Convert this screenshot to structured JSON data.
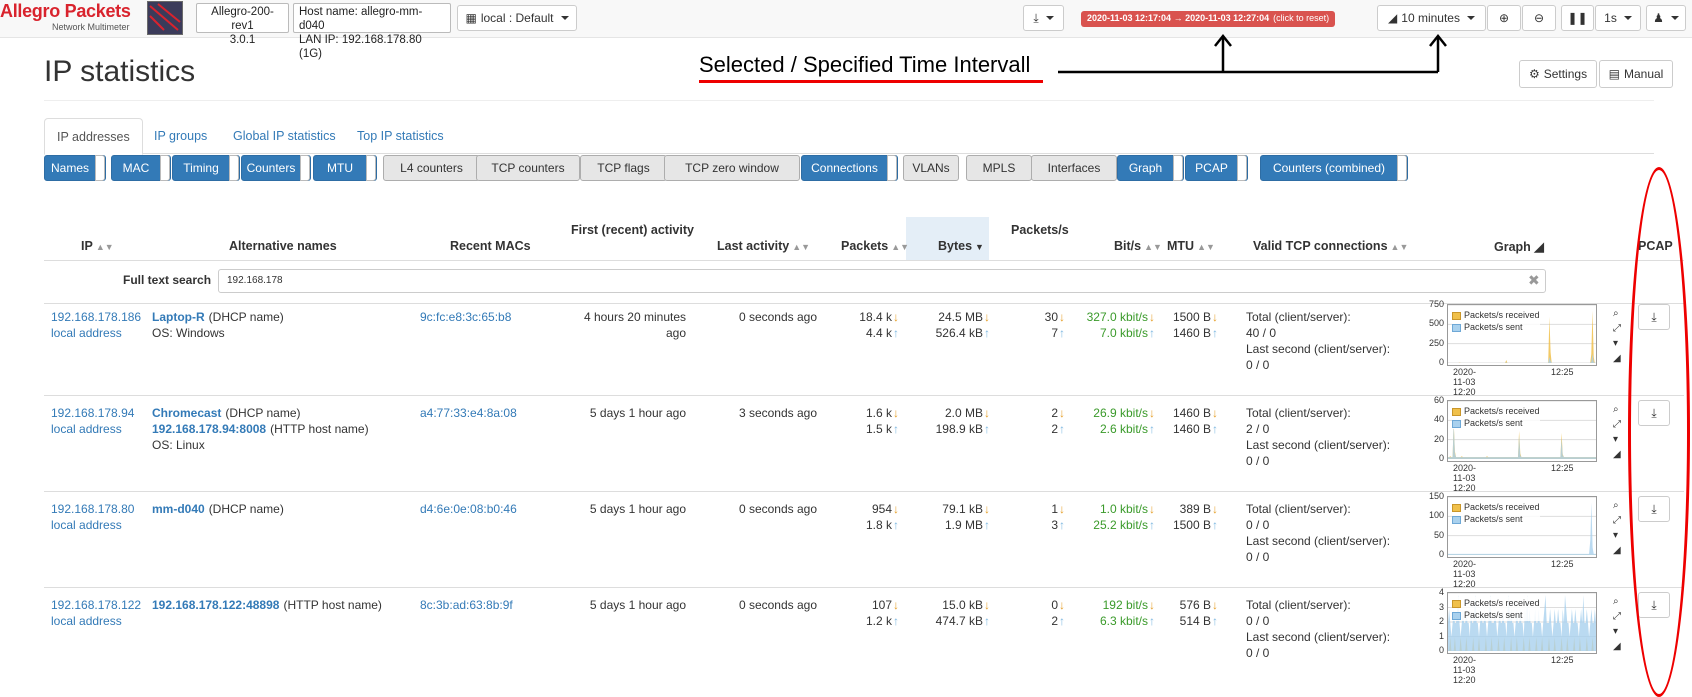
{
  "brand": {
    "title": "Allegro Packets",
    "subtitle": "Network Multimeter"
  },
  "device": {
    "model": "Allegro-200-rev1",
    "version": "3.0.1"
  },
  "host": {
    "hostname": "Host name: allegro-mm-d040",
    "lan_ip": "LAN IP: 192.168.178.80 (1G)"
  },
  "dashboard_select": "local : Default",
  "time_range": {
    "text": "2020-11-03 12:17:04 → 2020-11-03 12:27:04",
    "hint": "(click to reset)"
  },
  "interval_select": "10 minutes",
  "refresh_select": "1s",
  "annotation": "Selected / Specified Time Intervall",
  "page_title": "IP statistics",
  "header_buttons": {
    "settings": "Settings",
    "manual": "Manual"
  },
  "tabs": [
    "IP addresses",
    "IP groups",
    "Global IP statistics",
    "Top IP statistics"
  ],
  "column_toggles": [
    {
      "label": "Names",
      "on": true
    },
    {
      "label": "MAC",
      "on": true
    },
    {
      "label": "Timing",
      "on": true
    },
    {
      "label": "Counters",
      "on": true
    },
    {
      "label": "MTU",
      "on": true
    },
    {
      "label": "L4 counters",
      "on": false
    },
    {
      "label": "TCP counters",
      "on": false
    },
    {
      "label": "TCP flags",
      "on": false
    },
    {
      "label": "TCP zero window",
      "on": false
    },
    {
      "label": "Connections",
      "on": true
    },
    {
      "label": "VLANs",
      "on": false
    },
    {
      "label": "MPLS",
      "on": false
    },
    {
      "label": "Interfaces",
      "on": false
    },
    {
      "label": "Graph",
      "on": true
    },
    {
      "label": "PCAP",
      "on": true
    },
    {
      "label": "Counters (combined)",
      "on": true
    }
  ],
  "columns": {
    "ip": "IP",
    "alt_names": "Alternative names",
    "recent_macs": "Recent MACs",
    "first_activity": "First (recent) activity",
    "last_activity": "Last activity",
    "packets": "Packets",
    "bytes": "Bytes",
    "packets_s": "Packets/s",
    "bits_s": "Bit/s",
    "mtu": "MTU",
    "tcp_conn": "Valid TCP connections",
    "graph": "Graph",
    "pcap": "PCAP"
  },
  "search": {
    "label": "Full text search",
    "value": "192.168.178"
  },
  "legend": {
    "received": "Packets/s received",
    "sent": "Packets/s sent"
  },
  "graph_xlabels": [
    "2020-11-03 12:20",
    "12:25"
  ],
  "conn_labels": {
    "total": "Total (client/server):",
    "last": "Last second (client/server):"
  },
  "rows": [
    {
      "ip": "192.168.178.186",
      "ip_note": "local address",
      "name1": "Laptop-R",
      "name1_suffix": "(DHCP name)",
      "name2": "",
      "name2_suffix": "",
      "os": "OS: Windows",
      "mac": "9c:fc:e8:3c:65:b8",
      "first": [
        "4 hours 20 minutes",
        "ago"
      ],
      "last": "0 seconds ago",
      "packets_rx": "18.4 k",
      "packets_tx": "4.4 k",
      "bytes_rx": "24.5 MB",
      "bytes_tx": "526.4 kB",
      "pps_rx": "30",
      "pps_tx": "7",
      "bps_rx": "327.0 kbit/s",
      "bps_tx": "7.0 kbit/s",
      "mtu_rx": "1500 B",
      "mtu_tx": "1460 B",
      "conn_total": "40 / 0",
      "conn_last": "0 / 0",
      "yticks": [
        "750",
        "500",
        "250",
        "0"
      ],
      "ymax": 750,
      "received": [
        0,
        0,
        0,
        0,
        0,
        0,
        0,
        0,
        0,
        0,
        5,
        0,
        0,
        0,
        0,
        0,
        0,
        0,
        0,
        0,
        0,
        0,
        0,
        0,
        0,
        0,
        0,
        0,
        0,
        0,
        0,
        0,
        0,
        0,
        0,
        0,
        0,
        0,
        0,
        0,
        0,
        0,
        0,
        0,
        0,
        0,
        0,
        0,
        0,
        0,
        40,
        0,
        0,
        0,
        0,
        0,
        0,
        0,
        0,
        0,
        0,
        0,
        0,
        0,
        0,
        0,
        0,
        0,
        0,
        0,
        0,
        0,
        0,
        0,
        0,
        0,
        0,
        0,
        0,
        0,
        0,
        0,
        0,
        0,
        0,
        0,
        0,
        620,
        140,
        0,
        0,
        0,
        0,
        0,
        0,
        0,
        0,
        0,
        0,
        0,
        0,
        0,
        0,
        0,
        0,
        0,
        0,
        0,
        0,
        0,
        0,
        0,
        0,
        0,
        0,
        0,
        0,
        0,
        0,
        0,
        0,
        0,
        0,
        120,
        700,
        80,
        0,
        0
      ],
      "sent": [
        0,
        0,
        0,
        0,
        0,
        0,
        0,
        0,
        0,
        0,
        2,
        0,
        0,
        0,
        0,
        0,
        0,
        0,
        0,
        0,
        0,
        0,
        0,
        0,
        0,
        0,
        0,
        0,
        0,
        0,
        0,
        0,
        0,
        0,
        0,
        0,
        0,
        0,
        0,
        0,
        0,
        0,
        0,
        0,
        0,
        0,
        0,
        0,
        0,
        0,
        10,
        0,
        0,
        0,
        0,
        0,
        0,
        0,
        0,
        0,
        0,
        0,
        0,
        0,
        0,
        0,
        0,
        0,
        0,
        0,
        0,
        0,
        0,
        0,
        0,
        0,
        0,
        0,
        0,
        0,
        0,
        0,
        0,
        0,
        0,
        0,
        0,
        80,
        30,
        0,
        0,
        0,
        0,
        0,
        0,
        0,
        0,
        0,
        0,
        0,
        0,
        0,
        0,
        0,
        0,
        0,
        0,
        0,
        0,
        0,
        0,
        0,
        0,
        0,
        0,
        0,
        0,
        0,
        0,
        0,
        0,
        0,
        0,
        20,
        120,
        15,
        0,
        0
      ]
    },
    {
      "ip": "192.168.178.94",
      "ip_note": "local address",
      "name1": "Chromecast",
      "name1_suffix": "(DHCP name)",
      "name2": "192.168.178.94:8008",
      "name2_suffix": "(HTTP host name)",
      "os": "OS: Linux",
      "mac": "a4:77:33:e4:8a:08",
      "first": [
        "5 days 1 hour ago"
      ],
      "last": "3 seconds ago",
      "packets_rx": "1.6 k",
      "packets_tx": "1.5 k",
      "bytes_rx": "2.0 MB",
      "bytes_tx": "198.9 kB",
      "pps_rx": "2",
      "pps_tx": "2",
      "bps_rx": "26.9 kbit/s",
      "bps_tx": "2.6 kbit/s",
      "mtu_rx": "1460 B",
      "mtu_tx": "1460 B",
      "conn_total": "2 / 0",
      "conn_last": "0 / 0",
      "yticks": [
        "60",
        "40",
        "20",
        "0"
      ],
      "ymax": 60,
      "received": [
        2,
        2,
        3,
        2,
        2,
        40,
        8,
        2,
        2,
        2,
        2,
        2,
        3,
        2,
        2,
        2,
        2,
        2,
        2,
        2,
        2,
        2,
        2,
        2,
        2,
        2,
        2,
        2,
        2,
        2,
        2,
        2,
        2,
        2,
        3,
        2,
        2,
        2,
        2,
        2,
        2,
        2,
        2,
        2,
        2,
        2,
        2,
        2,
        2,
        2,
        2,
        2,
        2,
        2,
        2,
        2,
        2,
        2,
        2,
        2,
        2,
        2,
        30,
        6,
        2,
        2,
        2,
        2,
        2,
        2,
        2,
        2,
        2,
        2,
        2,
        2,
        2,
        2,
        2,
        2,
        2,
        2,
        2,
        2,
        2,
        2,
        2,
        2,
        2,
        2,
        2,
        2,
        2,
        2,
        2,
        2,
        2,
        2,
        2,
        28,
        5,
        2,
        2,
        2,
        2,
        2,
        2,
        2,
        2,
        2,
        2,
        2,
        2,
        2,
        2,
        2,
        2,
        2,
        2,
        2,
        2,
        2,
        2,
        2,
        2,
        2,
        2,
        2,
        2,
        2
      ],
      "sent": [
        2,
        2,
        2,
        2,
        2,
        38,
        6,
        2,
        2,
        2,
        2,
        2,
        2,
        2,
        2,
        2,
        2,
        2,
        2,
        2,
        2,
        2,
        2,
        2,
        2,
        2,
        2,
        2,
        2,
        2,
        2,
        2,
        2,
        2,
        2,
        2,
        2,
        2,
        2,
        2,
        2,
        2,
        2,
        2,
        2,
        2,
        2,
        2,
        2,
        2,
        2,
        2,
        2,
        2,
        2,
        2,
        2,
        2,
        2,
        2,
        2,
        2,
        25,
        4,
        2,
        2,
        2,
        2,
        2,
        2,
        2,
        2,
        2,
        2,
        2,
        2,
        2,
        2,
        2,
        2,
        2,
        2,
        2,
        2,
        2,
        2,
        2,
        2,
        2,
        2,
        2,
        2,
        2,
        2,
        2,
        2,
        2,
        2,
        2,
        22,
        4,
        2,
        2,
        2,
        2,
        2,
        2,
        2,
        2,
        2,
        2,
        2,
        2,
        2,
        2,
        2,
        2,
        2,
        2,
        2,
        2,
        2,
        2,
        2,
        2,
        2,
        2,
        2,
        2,
        2
      ]
    },
    {
      "ip": "192.168.178.80",
      "ip_note": "local address",
      "name1": "mm-d040",
      "name1_suffix": "(DHCP name)",
      "name2": "",
      "name2_suffix": "",
      "os": "",
      "mac": "d4:6e:0e:08:b0:46",
      "first": [
        "5 days 1 hour ago"
      ],
      "last": "0 seconds ago",
      "packets_rx": "954",
      "packets_tx": "1.8 k",
      "bytes_rx": "79.1 kB",
      "bytes_tx": "1.9 MB",
      "pps_rx": "1",
      "pps_tx": "3",
      "bps_rx": "1.0 kbit/s",
      "bps_tx": "25.2 kbit/s",
      "mtu_rx": "389 B",
      "mtu_tx": "1500 B",
      "conn_total": "0 / 0",
      "conn_last": "0 / 0",
      "yticks": [
        "150",
        "100",
        "50",
        "0"
      ],
      "ymax": 150,
      "received": [
        1,
        1,
        1,
        1,
        1,
        1,
        1,
        1,
        1,
        1,
        1,
        1,
        1,
        1,
        1,
        1,
        1,
        1,
        1,
        1,
        1,
        1,
        1,
        1,
        1,
        1,
        1,
        1,
        1,
        1,
        1,
        1,
        1,
        1,
        1,
        1,
        1,
        1,
        1,
        1,
        1,
        1,
        1,
        1,
        1,
        1,
        1,
        1,
        1,
        1,
        1,
        1,
        1,
        1,
        1,
        1,
        1,
        1,
        1,
        1,
        1,
        1,
        1,
        1,
        1,
        1,
        1,
        1,
        1,
        1,
        1,
        1,
        1,
        1,
        1,
        1,
        1,
        1,
        1,
        1,
        1,
        1,
        1,
        1,
        1,
        1,
        1,
        1,
        1,
        1,
        1,
        1,
        1,
        1,
        1,
        1,
        1,
        1,
        1,
        1,
        1,
        1,
        1,
        1,
        1,
        1,
        1,
        1,
        1,
        1,
        1,
        1,
        1,
        1,
        1,
        1,
        1,
        1,
        1,
        1,
        1,
        1,
        1,
        1,
        1,
        1,
        1,
        1,
        1,
        1
      ],
      "sent": [
        3,
        3,
        3,
        3,
        3,
        3,
        3,
        3,
        3,
        3,
        3,
        3,
        3,
        3,
        3,
        3,
        3,
        3,
        3,
        3,
        3,
        3,
        3,
        3,
        3,
        3,
        3,
        3,
        3,
        3,
        3,
        3,
        3,
        3,
        3,
        3,
        3,
        3,
        3,
        3,
        3,
        3,
        3,
        3,
        3,
        3,
        3,
        3,
        3,
        3,
        3,
        3,
        3,
        3,
        3,
        3,
        3,
        3,
        3,
        3,
        3,
        3,
        3,
        3,
        3,
        3,
        3,
        3,
        3,
        3,
        3,
        3,
        3,
        3,
        3,
        3,
        3,
        3,
        3,
        3,
        3,
        3,
        3,
        3,
        3,
        3,
        3,
        3,
        3,
        3,
        3,
        3,
        3,
        3,
        3,
        3,
        3,
        3,
        3,
        3,
        3,
        3,
        3,
        3,
        3,
        3,
        3,
        3,
        3,
        3,
        3,
        3,
        3,
        3,
        3,
        3,
        3,
        3,
        3,
        3,
        3,
        3,
        3,
        3,
        40,
        140,
        20,
        3,
        3,
        3
      ]
    },
    {
      "ip": "192.168.178.122",
      "ip_note": "local address",
      "name1": "192.168.178.122:48898",
      "name1_suffix": "(HTTP host name)",
      "name2": "",
      "name2_suffix": "",
      "os": "",
      "mac": "8c:3b:ad:63:8b:9f",
      "first": [
        "5 days 1 hour ago"
      ],
      "last": "0 seconds ago",
      "packets_rx": "107",
      "packets_tx": "1.2 k",
      "bytes_rx": "15.0 kB",
      "bytes_tx": "474.7 kB",
      "pps_rx": "0",
      "pps_tx": "2",
      "bps_rx": "192 bit/s",
      "bps_tx": "6.3 kbit/s",
      "mtu_rx": "576 B",
      "mtu_tx": "514 B",
      "conn_total": "0 / 0",
      "conn_last": "0 / 0",
      "yticks": [
        "4",
        "3",
        "2",
        "1",
        "0"
      ],
      "ymax": 4,
      "received": [
        0,
        0,
        1,
        0,
        0,
        0,
        1,
        0,
        0,
        0,
        0,
        1,
        0,
        0,
        0,
        0,
        1,
        0,
        0,
        0,
        0,
        0,
        1,
        0,
        0,
        0,
        0,
        1,
        0,
        0,
        0,
        0,
        0,
        1,
        0,
        0,
        0,
        0,
        1,
        0,
        0,
        0,
        0,
        0,
        1,
        0,
        0,
        0,
        0,
        1,
        0,
        0,
        0,
        0,
        0,
        1,
        0,
        0,
        0,
        0,
        1,
        0,
        0,
        0,
        0,
        0,
        1,
        0,
        0,
        0,
        0,
        1,
        0,
        0,
        0,
        0,
        0,
        1,
        0,
        0,
        0,
        0,
        1,
        0,
        0,
        0,
        0,
        0,
        1,
        0,
        0,
        0,
        0,
        1,
        0,
        0,
        0,
        0,
        0,
        1,
        0,
        0,
        0,
        0,
        1,
        0,
        0,
        0,
        0,
        0,
        1,
        0,
        0,
        0,
        0,
        1,
        0,
        0,
        0,
        0,
        0,
        1,
        0,
        0,
        0,
        0,
        1,
        0,
        0,
        0
      ],
      "sent": [
        2,
        3,
        2,
        1,
        2,
        3,
        2,
        2,
        3,
        4,
        2,
        1,
        2,
        3,
        2,
        2,
        3,
        2,
        2,
        1,
        3,
        2,
        2,
        3,
        4,
        2,
        2,
        1,
        2,
        3,
        2,
        2,
        3,
        2,
        1,
        2,
        3,
        4,
        2,
        2,
        2,
        3,
        2,
        1,
        2,
        3,
        2,
        2,
        3,
        2,
        2,
        1,
        3,
        4,
        2,
        3,
        2,
        2,
        1,
        2,
        3,
        2,
        2,
        3,
        2,
        2,
        1,
        3,
        2,
        4,
        2,
        3,
        2,
        2,
        1,
        2,
        3,
        2,
        2,
        3,
        2,
        2,
        1,
        2,
        3,
        4,
        2,
        2,
        2,
        3,
        2,
        1,
        2,
        3,
        2,
        2,
        3,
        2,
        2,
        1,
        3,
        2,
        4,
        3,
        2,
        2,
        1,
        2,
        3,
        2,
        2,
        3,
        2,
        2,
        1,
        2,
        3,
        2,
        4,
        2,
        2,
        3,
        2,
        1,
        2,
        3,
        2,
        2,
        3,
        2
      ]
    }
  ]
}
